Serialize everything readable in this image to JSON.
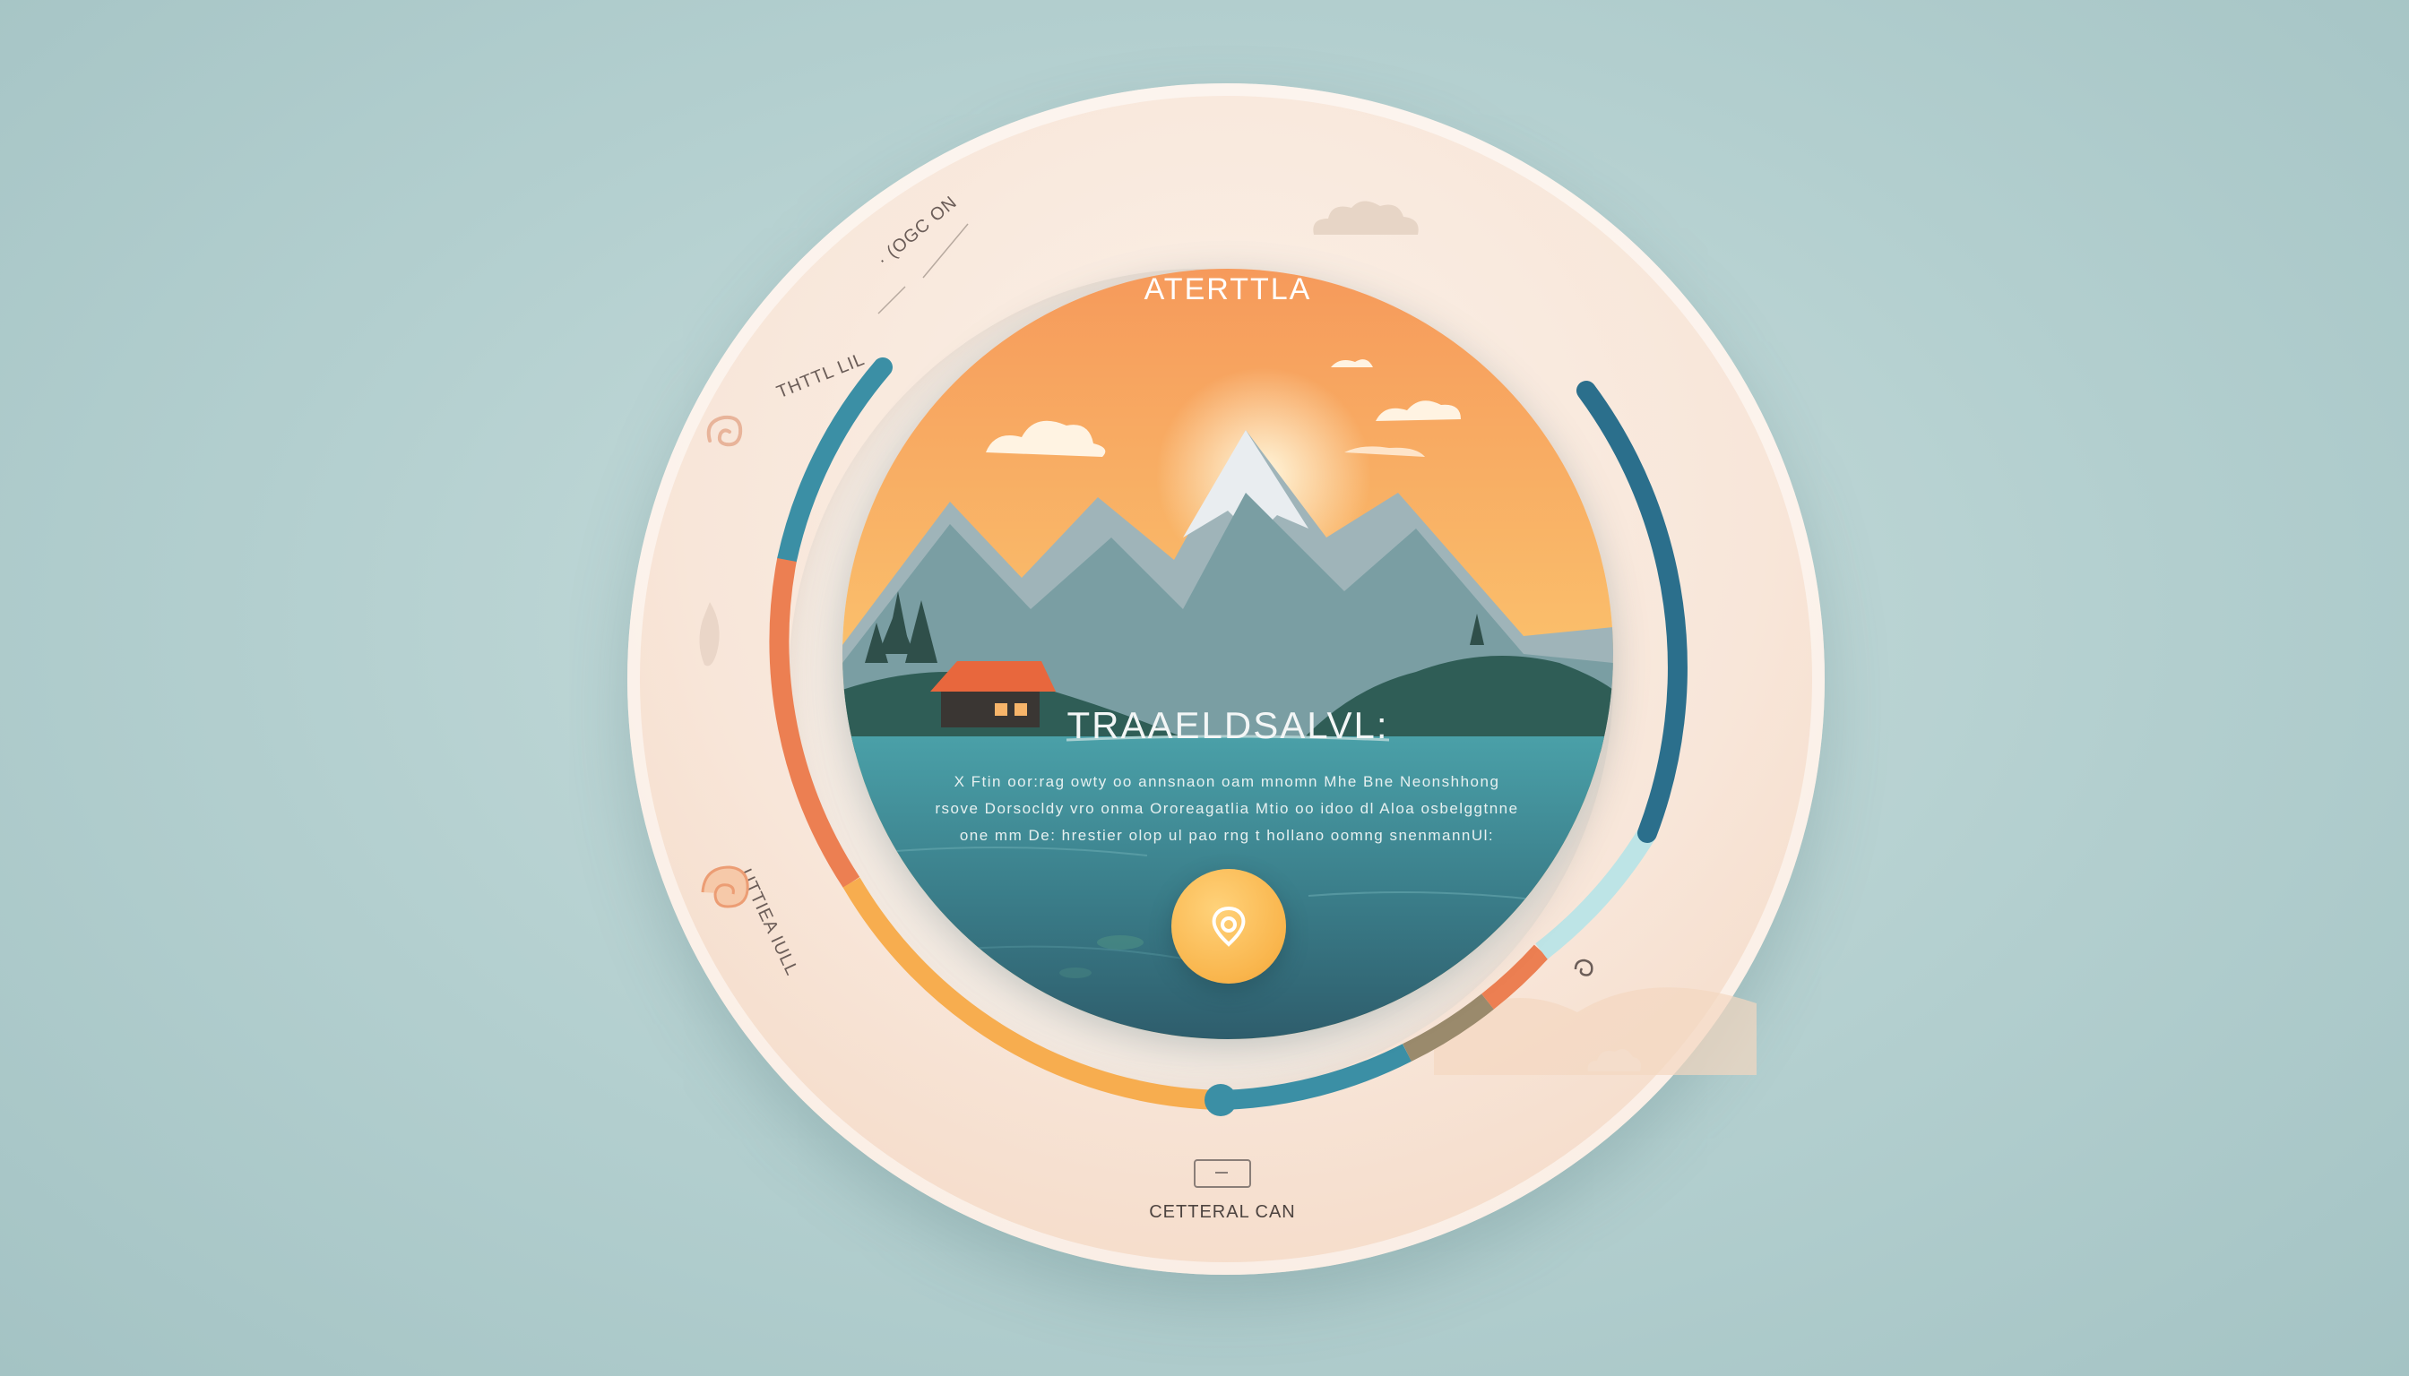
{
  "scene": {
    "title": "ATERTTLA",
    "headline": "TRAAELDSALVL:",
    "body_lines": [
      "X Ftin oor:rag owty oo  annsnaon oam mnomn Mhe   Bne Neonshhong",
      "rsove  Dorsocldy  vro onma Ororeagatlia  Mtio  oo idoo  dl Aloa osbelggtnne",
      "one  mm    De: hrestier  olop   ul   pao  rng t  hollano   oomng      snenmannUl:"
    ]
  },
  "side_labels": {
    "top": "· (OGC ON",
    "left": "THTTL LIL",
    "lower": "UTTIEA IULL"
  },
  "footer": {
    "label": "CETTERAL CAN"
  },
  "icons": {
    "play": "location-pin-icon",
    "left_top": "swirl-icon",
    "left_mid": "leaf-icon",
    "left_lower": "spiral-shell-icon",
    "right": "small-swirl-icon",
    "top_right": "cloud-icon",
    "bottom_right": "cloud-icon"
  },
  "colors": {
    "teal": "#3b8fa5",
    "navy_teal": "#2b6f8c",
    "coral": "#ec7f52",
    "amber": "#f7ad4f",
    "light_cyan": "#bde4e6",
    "olive_brown": "#9a8a6c",
    "sky_top": "#f69a5b",
    "sky_bottom": "#fbd37b",
    "water": "#3b7f8b"
  }
}
